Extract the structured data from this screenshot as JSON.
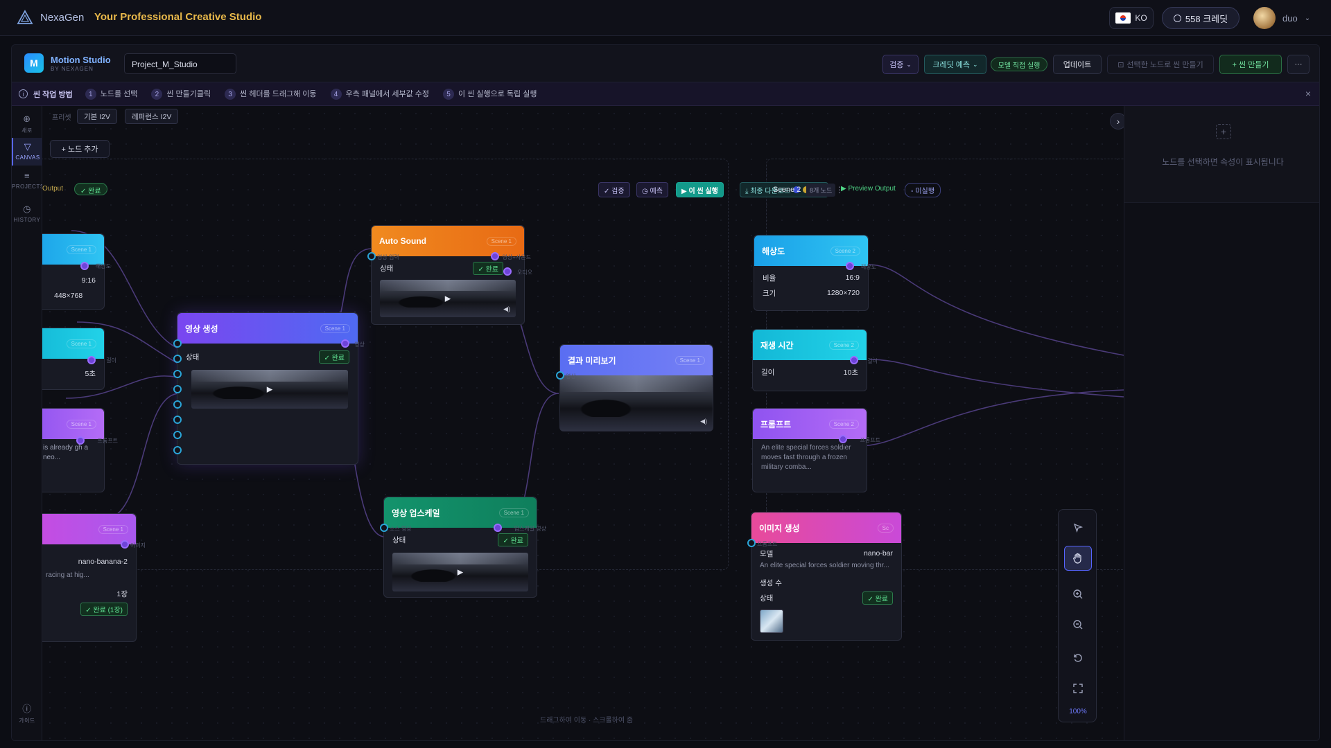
{
  "topbar": {
    "brand": "NexaGen",
    "tagline": "Your Professional Creative Studio",
    "lang": "KO",
    "credits": "558 크레딧",
    "user": "duo"
  },
  "header": {
    "app_title": "Motion Studio",
    "app_sub": "BY NEXAGEN",
    "project_name": "Project_M_Studio",
    "btn_validate": "검증",
    "btn_credit_predict": "크레딧 예측",
    "btn_model_direct": "모델 직접 실행",
    "btn_update": "업데이트",
    "btn_make_scene_selected": "선택한 노드로 씬 만들기",
    "btn_new_scene": "+ 씬 만들기",
    "btn_more": "···"
  },
  "steps": {
    "title": "씬 작업 방법",
    "items": [
      {
        "n": "1",
        "label": "노드를 선택"
      },
      {
        "n": "2",
        "label": "씬 만들기클릭"
      },
      {
        "n": "3",
        "label": "씬 헤더를 드래그해 이동"
      },
      {
        "n": "4",
        "label": "우측 패널에서 세부값 수정"
      },
      {
        "n": "5",
        "label": "이 씬 실행으로 독립 실행"
      }
    ],
    "close": "×"
  },
  "rail": {
    "new": "새로",
    "canvas": "CANVAS",
    "projects": "PROJECTS",
    "history": "HISTORY",
    "guide": "가이드"
  },
  "canvas": {
    "preset_label": "프리셋",
    "preset_1": "기본 I2V",
    "preset_2": "레퍼런스 I2V",
    "add_node": "+ 노드 추가",
    "hint": "드래그하여 이동 · 스크롤하여 줌",
    "zoom": "100%"
  },
  "scene1": {
    "output_label": "Output",
    "status": "✓ 완료",
    "tb_validate": "✓ 검증",
    "tb_predict": "◷ 예측",
    "tb_run": "▶ 이 씬 실행",
    "tb_download": "⤓ 최종 다운로드",
    "tb_more": "⋮",
    "node_res": {
      "tag": "Scene 1",
      "port_out": "해상도",
      "ratio": "9:16",
      "size": "448×768"
    },
    "node_dur": {
      "tag": "Scene 1",
      "port_out": "길이",
      "val": "5초"
    },
    "node_prompt": {
      "tag": "Scene 1",
      "port_out": "프롬프트",
      "text": "is already gh a neo..."
    },
    "node_image": {
      "tag": "Scene 1",
      "port_out": "이미지",
      "model": "nano-banana-2",
      "text": "racing at hig...",
      "count": "1장",
      "status": "✓ 완료 (1장)"
    },
    "node_video": {
      "title": "영상 생성",
      "tag": "Scene 1",
      "port_out": "영상",
      "status_label": "상태",
      "status": "✓ 완료"
    },
    "node_sound": {
      "title": "Auto Sound",
      "tag": "Scene 1",
      "port_in": "영상 입력",
      "port_out": "영상+사운드",
      "port_out2": "오디오",
      "status_label": "상태",
      "status": "✓ 완료"
    },
    "node_upscale": {
      "title": "영상 업스케일",
      "tag": "Scene 1",
      "port_in": "소스 영상",
      "port_out": "업스케일 영상",
      "status_label": "상태",
      "status": "✓ 완료"
    },
    "node_preview": {
      "title": "결과 미리보기",
      "tag": "Scene 1",
      "port_in": "영상"
    }
  },
  "scene2": {
    "title": "Scene 2",
    "count": "8개 노드",
    "output": "▶ Preview Output",
    "status": "◦ 미실행",
    "node_res": {
      "title": "해상도",
      "tag": "Scene 2",
      "port_out": "해상도",
      "ratio_label": "비율",
      "ratio": "16:9",
      "size_label": "크기",
      "size": "1280×720"
    },
    "node_dur": {
      "title": "재생 시간",
      "tag": "Scene 2",
      "port_out": "길이",
      "label": "길이",
      "val": "10초"
    },
    "node_prompt": {
      "title": "프롬프트",
      "tag": "Scene 2",
      "port_out": "프롬프트",
      "text": "An elite special forces soldier moves fast through a frozen military comba..."
    },
    "node_image": {
      "title": "이미지 생성",
      "tag": "Sc",
      "port_in": "프롬프트",
      "model_label": "모델",
      "model": "nano-bar",
      "text": "An elite special forces soldier moving thr...",
      "count_label": "생성 수",
      "status_label": "상태",
      "status": "✓ 완료"
    }
  },
  "panel": {
    "empty_text": "노드를 선택하면 속성이 표시됩니다",
    "add_icon": "+",
    "collapse": "›"
  }
}
